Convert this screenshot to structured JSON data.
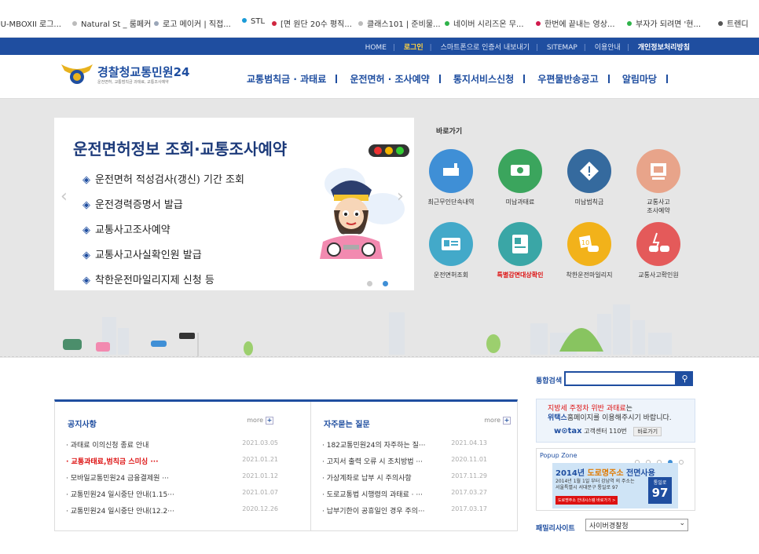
{
  "bookmarks": [
    {
      "label": "MU-MBOXII 로그...",
      "color": ""
    },
    {
      "label": "Natural St _ 룸페커",
      "color": "#bbbbbb"
    },
    {
      "label": "로고 메이커 | 직접...",
      "color": "#9aa6b8"
    },
    {
      "label": "STL",
      "color": "#1a9bd7"
    },
    {
      "label": "[면 원단 20수 평직...",
      "color": "#d0263f"
    },
    {
      "label": "클래스101 | 준비물...",
      "color": "#bbbbbb"
    },
    {
      "label": "네이버 시리즈온 무...",
      "color": "#2fb34a"
    },
    {
      "label": "한번에 끝내는 영상...",
      "color": "#d11a4d"
    },
    {
      "label": "부자가 되려면 '현...",
      "color": "#2fb34a"
    },
    {
      "label": "트렌디",
      "color": "#555555"
    }
  ],
  "toplinks": {
    "home": "HOME",
    "login": "로그인",
    "cert": "스마트폰으로 인증서 내보내기",
    "sitemap": "SITEMAP",
    "guide": "이용안내",
    "privacy": "개인정보처리방침"
  },
  "logo": {
    "main": "경찰청",
    "sub_brand": "교통민원24",
    "tagline": "운전면허, 교통범칙금 과태료, 교통조사예약"
  },
  "gnb": [
    "교통범칙금 · 과태료",
    "운전면허 · 조사예약",
    "통지서비스신청",
    "우편물반송공고",
    "알림마당"
  ],
  "slider": {
    "title": "운전면허정보 조회·교통조사예약",
    "items": [
      "운전면허 적성검사(갱신) 기간 조회",
      "운전경력증명서 발급",
      "교통사고조사예약",
      "교통사고사실확인원 발급",
      "착한운전마일리지제 신청 등"
    ],
    "bullet": "◈"
  },
  "quick": {
    "title": "바로가기",
    "items": [
      {
        "label": "최근무인단속내역",
        "color": "#3f8fd6",
        "icon": "camera-icon"
      },
      {
        "label": "미납과태료",
        "color": "#3ba55d",
        "icon": "money-icon"
      },
      {
        "label": "미납범칙금",
        "color": "#356a9e",
        "icon": "warning-sign-icon"
      },
      {
        "label": "교통사고\n조사예약",
        "color": "#e8a48a",
        "icon": "monitor-icon"
      },
      {
        "label": "운전면허조회",
        "color": "#43a9c9",
        "icon": "license-card-icon"
      },
      {
        "label": "특별감면대상확인",
        "color": "#3aa6a6",
        "icon": "id-card-icon"
      },
      {
        "label": "착한운전마일리지",
        "color": "#f2b21a",
        "icon": "mileage-icon"
      },
      {
        "label": "교통사고확인원",
        "color": "#e45a5a",
        "icon": "car-crash-icon"
      }
    ]
  },
  "notice": {
    "title": "공지사항",
    "more": "more",
    "rows": [
      {
        "text": "과태료 이의신청 종료 안내",
        "date": "2021.03.05",
        "highlight": false
      },
      {
        "text": "교통과태료,범칙금 스미싱 ···",
        "date": "2021.01.21",
        "highlight": true
      },
      {
        "text": "모바일교통민원24 금융결제원 ···",
        "date": "2021.01.12",
        "highlight": false
      },
      {
        "text": "교통민원24 일시중단 안내(1.15···",
        "date": "2021.01.07",
        "highlight": false
      },
      {
        "text": "교통민원24 일시중단 안내(12.2···",
        "date": "2020.12.26",
        "highlight": false
      }
    ]
  },
  "faq": {
    "title": "자주묻는 질문",
    "more": "more",
    "rows": [
      {
        "text": "182교통민원24의 자주하는 질···",
        "date": "2021.04.13"
      },
      {
        "text": "고지서 출력 오류 시 조치방법 ···",
        "date": "2020.11.01"
      },
      {
        "text": "가상계좌로 납부 시 주의사항",
        "date": "2017.11.29"
      },
      {
        "text": "도로교통법 시행령의 과태료 · ···",
        "date": "2017.03.27"
      },
      {
        "text": "납부기한이 공휴일인 경우 주의···",
        "date": "2017.03.17"
      }
    ]
  },
  "search": {
    "label": "통합검색",
    "value": ""
  },
  "banner1": {
    "line1_red": "지방세 주정차 위반 과태료",
    "line1_rest": "는",
    "line2_bold": "위택스",
    "line2_rest": "홈페이지를 이용해주시기 바랍니다.",
    "wetax": "w⊙tax",
    "center": "고객센터 110번",
    "button": "바로가기"
  },
  "popup": {
    "label": "Popup Zone",
    "banner_title_a": "2014년 ",
    "banner_title_b": "도로명주소",
    "banner_title_c": " 전면사용",
    "banner_line1": "2014년 1월 1일 부터 강남역 의 주소는",
    "banner_line2": "서울특별시 서대문구 통일로 97",
    "banner_btn": "도로명주소 안내시스템 바로가기 >",
    "road_label": "통일로",
    "road_no": "97"
  },
  "family": {
    "label": "패밀리사이트",
    "selected": "사이버경찰청"
  }
}
